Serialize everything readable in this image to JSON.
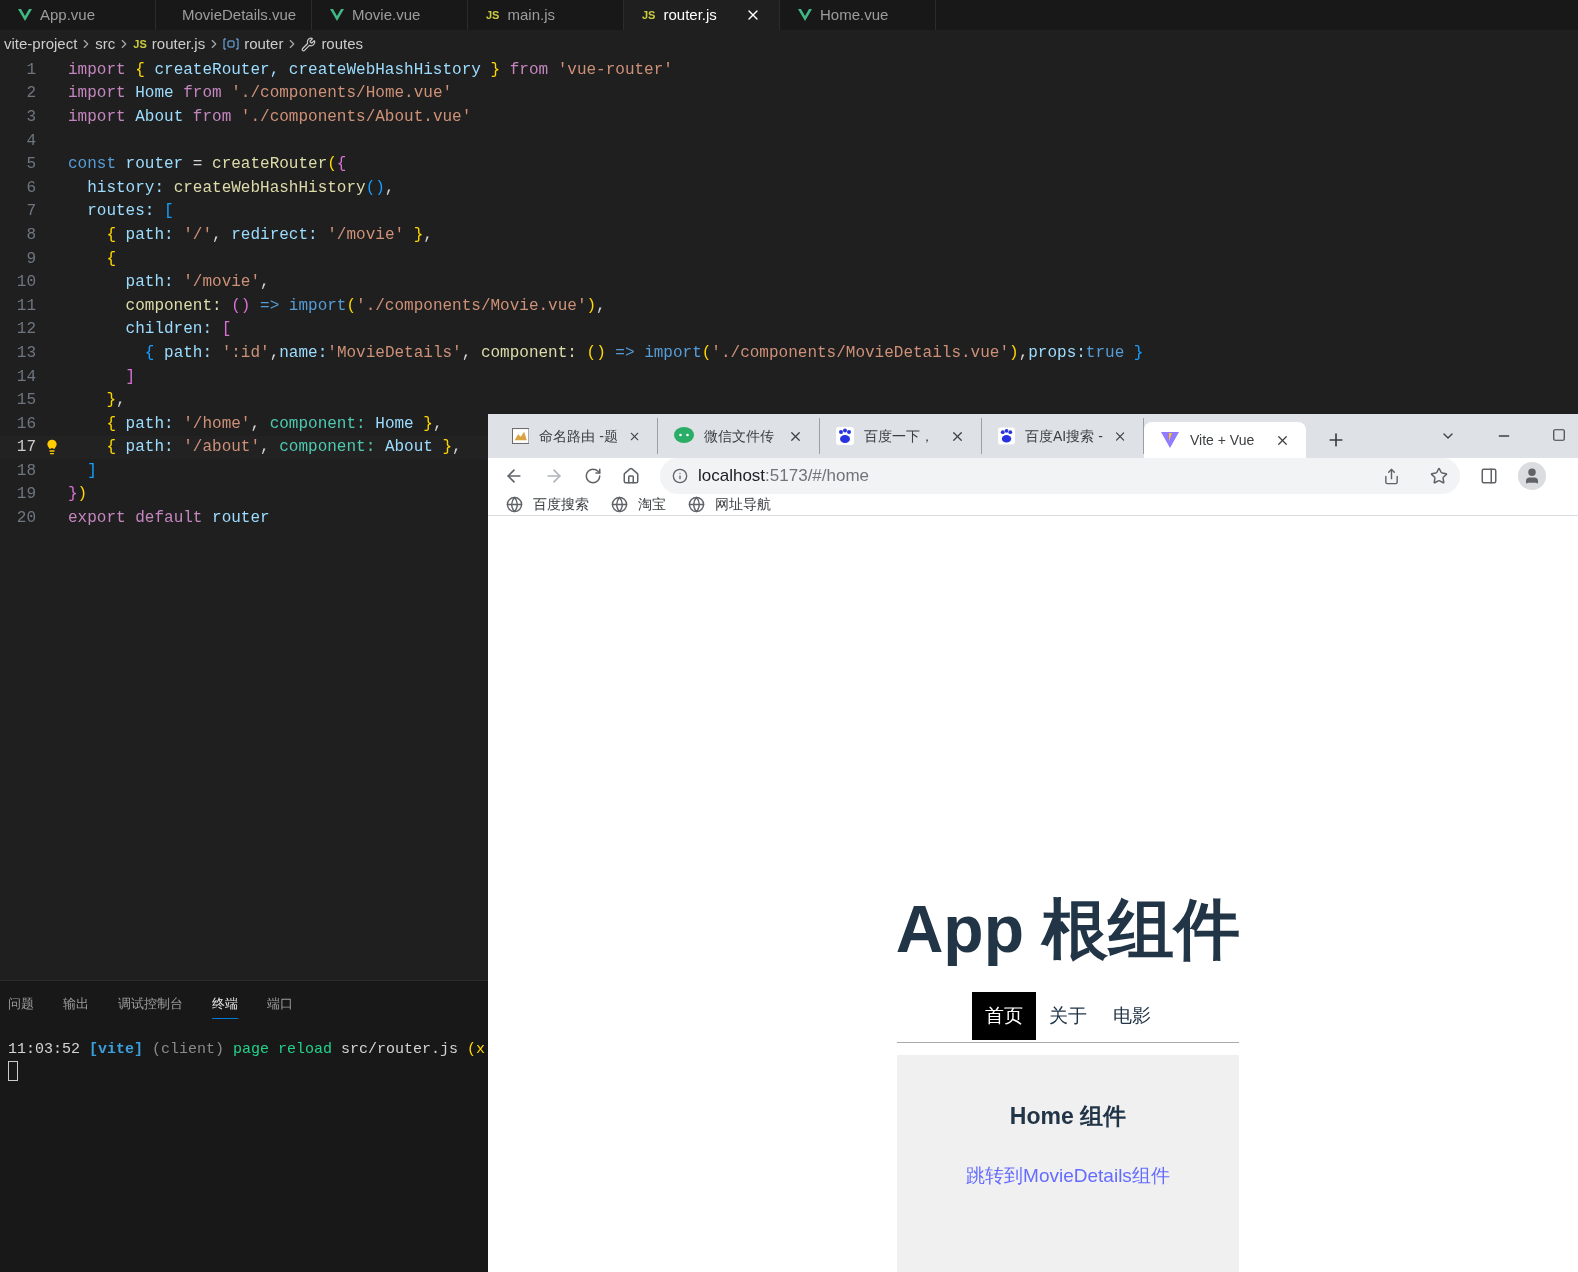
{
  "editor": {
    "tabs": [
      {
        "label": "App.vue",
        "kind": "vue",
        "selected": false
      },
      {
        "label": "MovieDetails.vue",
        "kind": "vue",
        "selected": false
      },
      {
        "label": "Movie.vue",
        "kind": "vue",
        "selected": false
      },
      {
        "label": "main.js",
        "kind": "js",
        "badge": "JS",
        "selected": false
      },
      {
        "label": "router.js",
        "kind": "js",
        "badge": "JS",
        "selected": true
      },
      {
        "label": "Home.vue",
        "kind": "vue",
        "selected": false
      }
    ],
    "breadcrumb": [
      {
        "label": "vite-project",
        "kind": "folder"
      },
      {
        "label": "src",
        "kind": "folder"
      },
      {
        "label": "router.js",
        "kind": "js",
        "badge": "JS"
      },
      {
        "label": "router",
        "kind": "variable"
      },
      {
        "label": "routes",
        "kind": "property"
      }
    ],
    "lines": [
      {
        "n": "1",
        "current": false,
        "tokens": [
          {
            "text": "import ",
            "kind": "kw"
          },
          {
            "text": "{ ",
            "kind": "b1"
          },
          {
            "text": "createRouter, createWebHashHistory ",
            "kind": "id"
          },
          {
            "text": "} ",
            "kind": "b1"
          },
          {
            "text": "from ",
            "kind": "kw"
          },
          {
            "text": "'vue-router'",
            "kind": "str"
          }
        ]
      },
      {
        "n": "2",
        "current": false,
        "tokens": [
          {
            "text": "import ",
            "kind": "kw"
          },
          {
            "text": "Home ",
            "kind": "id"
          },
          {
            "text": "from ",
            "kind": "kw"
          },
          {
            "text": "'./components/Home.vue'",
            "kind": "str"
          }
        ]
      },
      {
        "n": "3",
        "current": false,
        "tokens": [
          {
            "text": "import ",
            "kind": "kw"
          },
          {
            "text": "About ",
            "kind": "id"
          },
          {
            "text": "from ",
            "kind": "kw"
          },
          {
            "text": "'./components/About.vue'",
            "kind": "str"
          }
        ]
      },
      {
        "n": "4",
        "current": false
      },
      {
        "n": "5",
        "current": false,
        "tokens": [
          {
            "text": "const ",
            "kind": "const"
          },
          {
            "text": "router ",
            "kind": "id"
          },
          {
            "text": "= ",
            "kind": "p"
          },
          {
            "text": "createRouter",
            "kind": "fn"
          },
          {
            "text": "(",
            "kind": "b1"
          },
          {
            "text": "{",
            "kind": "b2"
          }
        ]
      },
      {
        "n": "6",
        "current": false,
        "tokens": [
          {
            "text": "  history: ",
            "kind": "id"
          },
          {
            "text": "createWebHashHistory",
            "kind": "fn"
          },
          {
            "text": "()",
            "kind": "b3"
          },
          {
            "text": ",",
            "kind": "p"
          }
        ]
      },
      {
        "n": "7",
        "current": false,
        "tokens": [
          {
            "text": "  routes: ",
            "kind": "id"
          },
          {
            "text": "[",
            "kind": "b3"
          }
        ]
      },
      {
        "n": "8",
        "current": false,
        "tokens": [
          {
            "text": "    {",
            "kind": "b1"
          },
          {
            "text": " path: ",
            "kind": "id"
          },
          {
            "text": "'/'",
            "kind": "str"
          },
          {
            "text": ", ",
            "kind": "p"
          },
          {
            "text": "redirect: ",
            "kind": "id"
          },
          {
            "text": "'/movie'",
            "kind": "str"
          },
          {
            "text": " }",
            "kind": "b1"
          },
          {
            "text": ",",
            "kind": "p"
          }
        ]
      },
      {
        "n": "9",
        "current": false,
        "tokens": [
          {
            "text": "    {",
            "kind": "b1"
          }
        ]
      },
      {
        "n": "10",
        "current": false,
        "tokens": [
          {
            "text": "      path: ",
            "kind": "id"
          },
          {
            "text": "'/movie'",
            "kind": "str"
          },
          {
            "text": ",",
            "kind": "p"
          }
        ]
      },
      {
        "n": "11",
        "current": false,
        "tokens": [
          {
            "text": "      component: ",
            "kind": "fn"
          },
          {
            "text": "()",
            "kind": "b2"
          },
          {
            "text": " => ",
            "kind": "const"
          },
          {
            "text": "import",
            "kind": "const"
          },
          {
            "text": "(",
            "kind": "b1"
          },
          {
            "text": "'./components/Movie.vue'",
            "kind": "str"
          },
          {
            "text": ")",
            "kind": "b1"
          },
          {
            "text": ",",
            "kind": "p"
          }
        ]
      },
      {
        "n": "12",
        "current": false,
        "tokens": [
          {
            "text": "      children: ",
            "kind": "id"
          },
          {
            "text": "[",
            "kind": "b2"
          }
        ]
      },
      {
        "n": "13",
        "current": false,
        "tokens": [
          {
            "text": "        {",
            "kind": "b3"
          },
          {
            "text": " path: ",
            "kind": "id"
          },
          {
            "text": "':id'",
            "kind": "str"
          },
          {
            "text": ",",
            "kind": "p"
          },
          {
            "text": "name:",
            "kind": "id"
          },
          {
            "text": "'MovieDetails'",
            "kind": "str"
          },
          {
            "text": ", ",
            "kind": "p"
          },
          {
            "text": "component: ",
            "kind": "fn"
          },
          {
            "text": "()",
            "kind": "b1"
          },
          {
            "text": " => ",
            "kind": "const"
          },
          {
            "text": "import",
            "kind": "const"
          },
          {
            "text": "(",
            "kind": "b1"
          },
          {
            "text": "'./components/MovieDetails.vue'",
            "kind": "str"
          },
          {
            "text": ")",
            "kind": "b1"
          },
          {
            "text": ",",
            "kind": "p"
          },
          {
            "text": "props:",
            "kind": "id"
          },
          {
            "text": "true",
            "kind": "const"
          },
          {
            "text": " }",
            "kind": "b3"
          }
        ]
      },
      {
        "n": "14",
        "current": false,
        "tokens": [
          {
            "text": "      ]",
            "kind": "b2"
          }
        ]
      },
      {
        "n": "15",
        "current": false,
        "tokens": [
          {
            "text": "    }",
            "kind": "b1"
          },
          {
            "text": ",",
            "kind": "p"
          }
        ]
      },
      {
        "n": "16",
        "current": false,
        "tokens": [
          {
            "text": "    {",
            "kind": "b1"
          },
          {
            "text": " path: ",
            "kind": "id"
          },
          {
            "text": "'/home'",
            "kind": "str"
          },
          {
            "text": ", ",
            "kind": "p"
          },
          {
            "text": "component: ",
            "kind": "cls"
          },
          {
            "text": "Home ",
            "kind": "id"
          },
          {
            "text": "}",
            "kind": "b1"
          },
          {
            "text": ",",
            "kind": "p"
          }
        ]
      },
      {
        "n": "17",
        "current": true,
        "tokens": [
          {
            "text": "    {",
            "kind": "b1"
          },
          {
            "text": " path: ",
            "kind": "id"
          },
          {
            "text": "'/about'",
            "kind": "str"
          },
          {
            "text": ", ",
            "kind": "p"
          },
          {
            "text": "component: ",
            "kind": "cls"
          },
          {
            "text": "About ",
            "kind": "id"
          },
          {
            "text": "}",
            "kind": "b1"
          },
          {
            "text": ",",
            "kind": "p"
          }
        ]
      },
      {
        "n": "18",
        "current": false,
        "tokens": [
          {
            "text": "  ]",
            "kind": "b3"
          }
        ]
      },
      {
        "n": "19",
        "current": false,
        "tokens": [
          {
            "text": "}",
            "kind": "b2"
          },
          {
            "text": ")",
            "kind": "b1"
          }
        ]
      },
      {
        "n": "20",
        "current": false,
        "tokens": [
          {
            "text": "export ",
            "kind": "kw"
          },
          {
            "text": "default ",
            "kind": "kw"
          },
          {
            "text": "router",
            "kind": "id"
          }
        ]
      }
    ]
  },
  "panel": {
    "tabs": [
      {
        "label": "问题",
        "selected": false
      },
      {
        "label": "输出",
        "selected": false
      },
      {
        "label": "调试控制台",
        "selected": false
      },
      {
        "label": "终端",
        "selected": true
      },
      {
        "label": "端口",
        "selected": false
      }
    ],
    "terminal_line": [
      {
        "text": "11:03:52 ",
        "kind": "p"
      },
      {
        "text": "[vite]",
        "kind": "vite"
      },
      {
        "text": " (client) ",
        "kind": "dim"
      },
      {
        "text": "page reload ",
        "kind": "green"
      },
      {
        "text": "src/router.js ",
        "kind": "p"
      },
      {
        "text": "(x",
        "kind": "b1"
      }
    ]
  },
  "browser": {
    "tabs": [
      {
        "label": "命名路由 -题",
        "kind": "cat",
        "selected": false
      },
      {
        "label": "微信文件传",
        "kind": "chat",
        "selected": false
      },
      {
        "label": "百度一下，",
        "kind": "paw",
        "selected": false
      },
      {
        "label": "百度AI搜索 -",
        "kind": "paw",
        "selected": false
      },
      {
        "label": "Vite + Vue",
        "kind": "vite",
        "selected": true
      }
    ],
    "url": {
      "host": "localhost",
      "rest": ":5173/#/home"
    },
    "bookmarks": [
      "百度搜索",
      "淘宝",
      "网址导航"
    ],
    "page": {
      "title": "App 根组件",
      "nav": [
        {
          "label": "首页",
          "selected": true
        },
        {
          "label": "关于",
          "selected": false
        },
        {
          "label": "电影",
          "selected": false
        }
      ],
      "card": {
        "heading": "Home 组件",
        "link": "跳转到MovieDetails组件"
      }
    }
  }
}
